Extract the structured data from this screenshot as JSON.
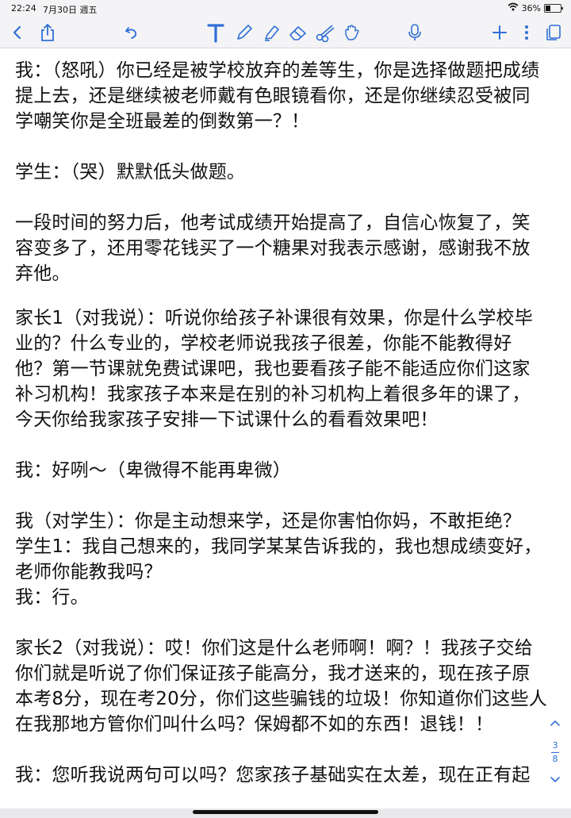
{
  "status": {
    "time": "22:24",
    "date": "7月30日 週五",
    "battery_percent": "36%"
  },
  "toolbar": {
    "accent": "#2f6fd6",
    "tools": [
      "back-icon",
      "share-icon",
      "undo-icon",
      "text-tool-icon",
      "pen-icon",
      "highlighter-icon",
      "eraser-icon",
      "scissors-icon",
      "hand-icon",
      "microphone-icon",
      "add-icon",
      "more-icon",
      "pages-icon"
    ]
  },
  "document": {
    "paragraphs": [
      "我：（怒吼）你已经是被学校放弃的差等生，你是选择做题把成绩提上去，还是继续被老师戴有色眼镜看你，还是你继续忍受被同学嘲笑你是全班最差的倒数第一？！",
      "学生：（哭）默默低头做题。",
      "一段时间的努力后，他考试成绩开始提高了，自信心恢复了，笑容变多了，还用零花钱买了一个糖果对我表示感谢，感谢我不放弃他。",
      "家长1（对我说）：听说你给孩子补课很有效果，你是什么学校毕业的？什么专业的，学校老师说我孩子很差，你能不能教得好他？第一节课就免费试课吧，我也要看孩子能不能适应你们这家补习机构！我家孩子本来是在别的补习机构上着很多年的课了，今天你给我家孩子安排一下试课什么的看看效果吧！",
      "我：好咧～（卑微得不能再卑微）"
    ],
    "dialogue": [
      "我（对学生）：你是主动想来学，还是你害怕你妈，不敢拒绝？",
      "学生1：我自己想来的，我同学某某告诉我的，我也想成绩变好，老师你能教我吗？",
      "我：行。"
    ],
    "paragraphs2": [
      "家长2（对我说）：哎！你们这是什么老师啊！啊？！我孩子交给你们就是听说了你们保证孩子能高分，我才送来的，现在孩子原本考8分，现在考20分，你们这些骗钱的垃圾！你知道你们这些人在我那地方管你们叫什么吗？保姆都不如的东西！退钱！！",
      "我：您听我说两句可以吗？您家孩子基础实在太差，现在正有起"
    ]
  },
  "pager": {
    "current": "3",
    "total": "8"
  }
}
